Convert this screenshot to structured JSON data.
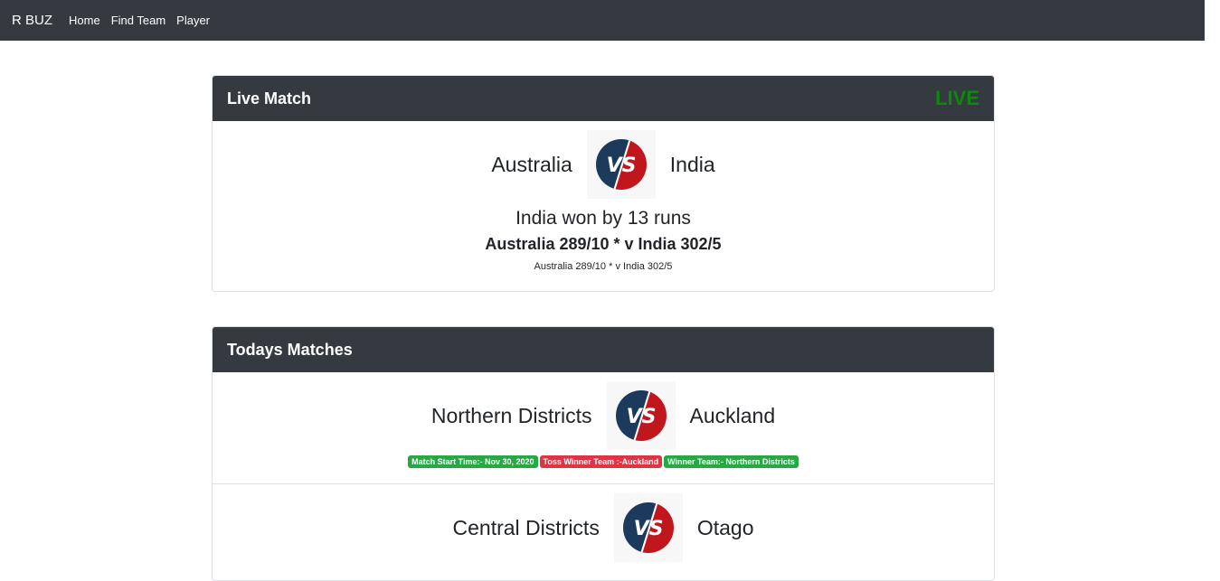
{
  "nav": {
    "brand": "R BUZ",
    "links": [
      "Home",
      "Find Team",
      "Player"
    ]
  },
  "live_card": {
    "title": "Live Match",
    "live_label": "LIVE",
    "team1": "Australia",
    "team2": "India",
    "result": "India won by 13 runs",
    "score_large": "Australia 289/10 * v India 302/5",
    "score_small": "Australia 289/10 * v India 302/5"
  },
  "todays_card": {
    "title": "Todays Matches",
    "matches": [
      {
        "team1": "Northern Districts",
        "team2": "Auckland",
        "badge_start": "Match Start Time:- Nov 30, 2020",
        "badge_toss": "Toss Winner Team :-Auckland",
        "badge_winner": "Winner Team:- Northern Districts"
      },
      {
        "team1": "Central Districts",
        "team2": "Otago"
      }
    ]
  },
  "colors": {
    "navbar": "#343a40",
    "live": "#0a8a0a",
    "badge_green": "#28a745",
    "badge_red": "#dc3545",
    "vs_blue": "#1b3a5c",
    "vs_red": "#c0171f"
  }
}
